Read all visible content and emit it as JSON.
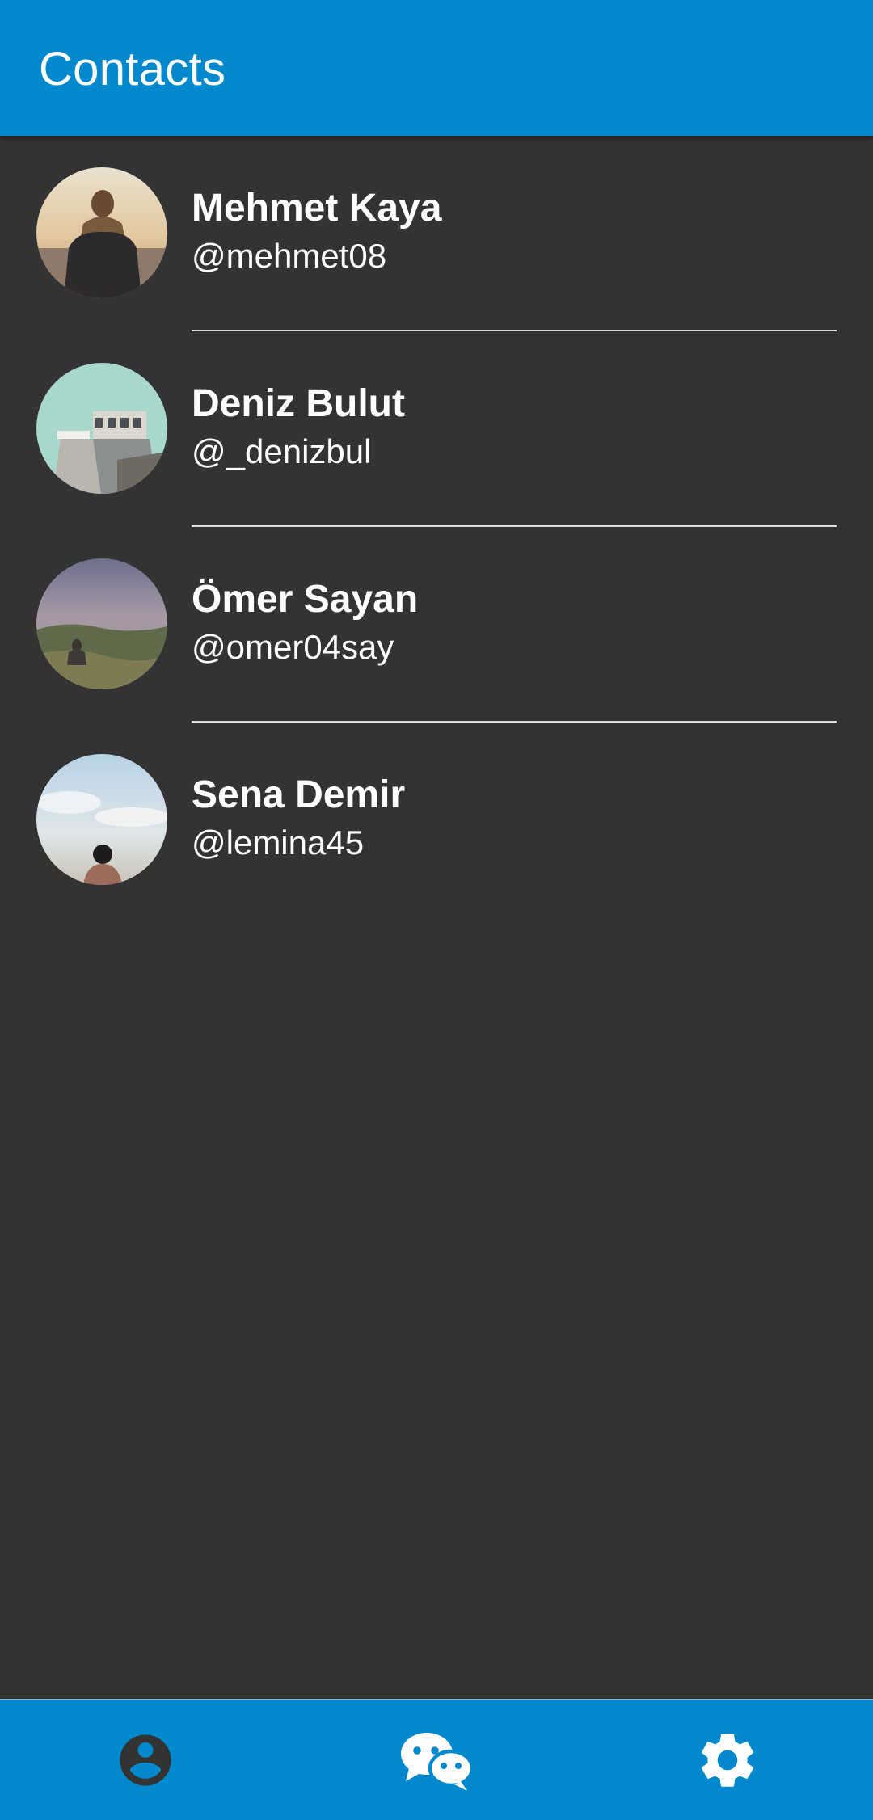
{
  "app_bar": {
    "title": "Contacts"
  },
  "contacts": [
    {
      "name": "Mehmet Kaya",
      "handle": "@mehmet08",
      "avatar": "photo-person-in-scarf-sunset"
    },
    {
      "name": "Deniz Bulut",
      "handle": "@_denizbul",
      "avatar": "photo-building-sky"
    },
    {
      "name": "Ömer Sayan",
      "handle": "@omer04say",
      "avatar": "photo-person-sitting-landscape"
    },
    {
      "name": "Sena Demir",
      "handle": "@lemina45",
      "avatar": "photo-person-back-sky"
    }
  ],
  "bottom_nav": {
    "items": [
      {
        "icon": "account-circle-icon",
        "active": true
      },
      {
        "icon": "chat-bubbles-icon",
        "active": false
      },
      {
        "icon": "gear-icon",
        "active": false
      }
    ]
  },
  "colors": {
    "primary": "#0288cc",
    "background": "#333333",
    "text": "#ffffff",
    "active_icon": "#333333"
  }
}
